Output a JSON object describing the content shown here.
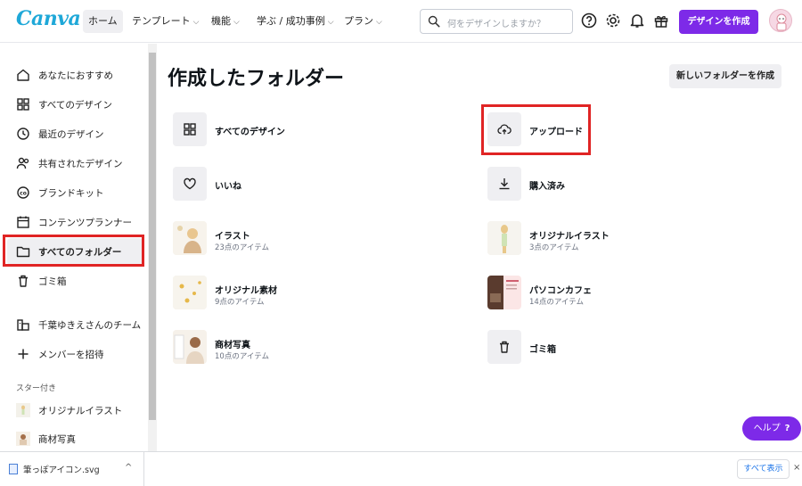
{
  "app": {
    "logo": "Canva"
  },
  "nav": {
    "home": "ホーム",
    "templates": "テンプレート",
    "features": "機能",
    "learn": "学ぶ / 成功事例",
    "plans": "プラン",
    "chevron": "⌵"
  },
  "search": {
    "placeholder": "何をデザインしますか？",
    "icon": "search-icon"
  },
  "header_icons": [
    "help-circle-icon",
    "gear-icon",
    "bell-icon",
    "gift-icon"
  ],
  "create_button": "デザインを作成",
  "sidebar": {
    "items": [
      {
        "label": "あなたにおすすめ",
        "icon": "home-icon"
      },
      {
        "label": "すべてのデザイン",
        "icon": "grid-icon"
      },
      {
        "label": "最近のデザイン",
        "icon": "clock-icon"
      },
      {
        "label": "共有されたデザイン",
        "icon": "people-icon"
      },
      {
        "label": "ブランドキット",
        "icon": "brand-icon"
      },
      {
        "label": "コンテンツプランナー",
        "icon": "calendar-icon"
      },
      {
        "label": "すべてのフォルダー",
        "icon": "folder-icon",
        "active": true
      },
      {
        "label": "ゴミ箱",
        "icon": "trash-icon"
      }
    ],
    "team": {
      "label": "千葉ゆきえさんのチーム",
      "icon": "team-icon"
    },
    "invite": {
      "label": "メンバーを招待",
      "icon": "plus-icon"
    },
    "starred_label": "スター付き",
    "starred": [
      {
        "label": "オリジナルイラスト"
      },
      {
        "label": "商材写真"
      }
    ]
  },
  "main": {
    "title": "作成したフォルダー",
    "new_folder_button": "新しいフォルダーを作成",
    "folders": [
      {
        "name": "すべてのデザイン",
        "icon": "grid-icon"
      },
      {
        "name": "アップロード",
        "icon": "cloud-upload-icon"
      },
      {
        "name": "いいね",
        "icon": "heart-icon"
      },
      {
        "name": "購入済み",
        "icon": "download-icon"
      },
      {
        "name": "イラスト",
        "count": "23点のアイテム"
      },
      {
        "name": "オリジナルイラスト",
        "count": "3点のアイテム"
      },
      {
        "name": "オリジナル素材",
        "count": "9点のアイテム"
      },
      {
        "name": "パソコンカフェ",
        "count": "14点のアイテム"
      },
      {
        "name": "商材写真",
        "count": "10点のアイテム"
      },
      {
        "name": "ゴミ箱",
        "icon": "trash-icon"
      }
    ]
  },
  "help_button": {
    "label": "ヘルプ",
    "mark": "?"
  },
  "download_bar": {
    "file": "筆っぽアイコン.svg",
    "caret": "^",
    "show_all": "すべて表示",
    "close": "×"
  },
  "colors": {
    "accent": "#7d2ae8",
    "highlight": "#e02424",
    "logo": "#1fa8d8"
  }
}
